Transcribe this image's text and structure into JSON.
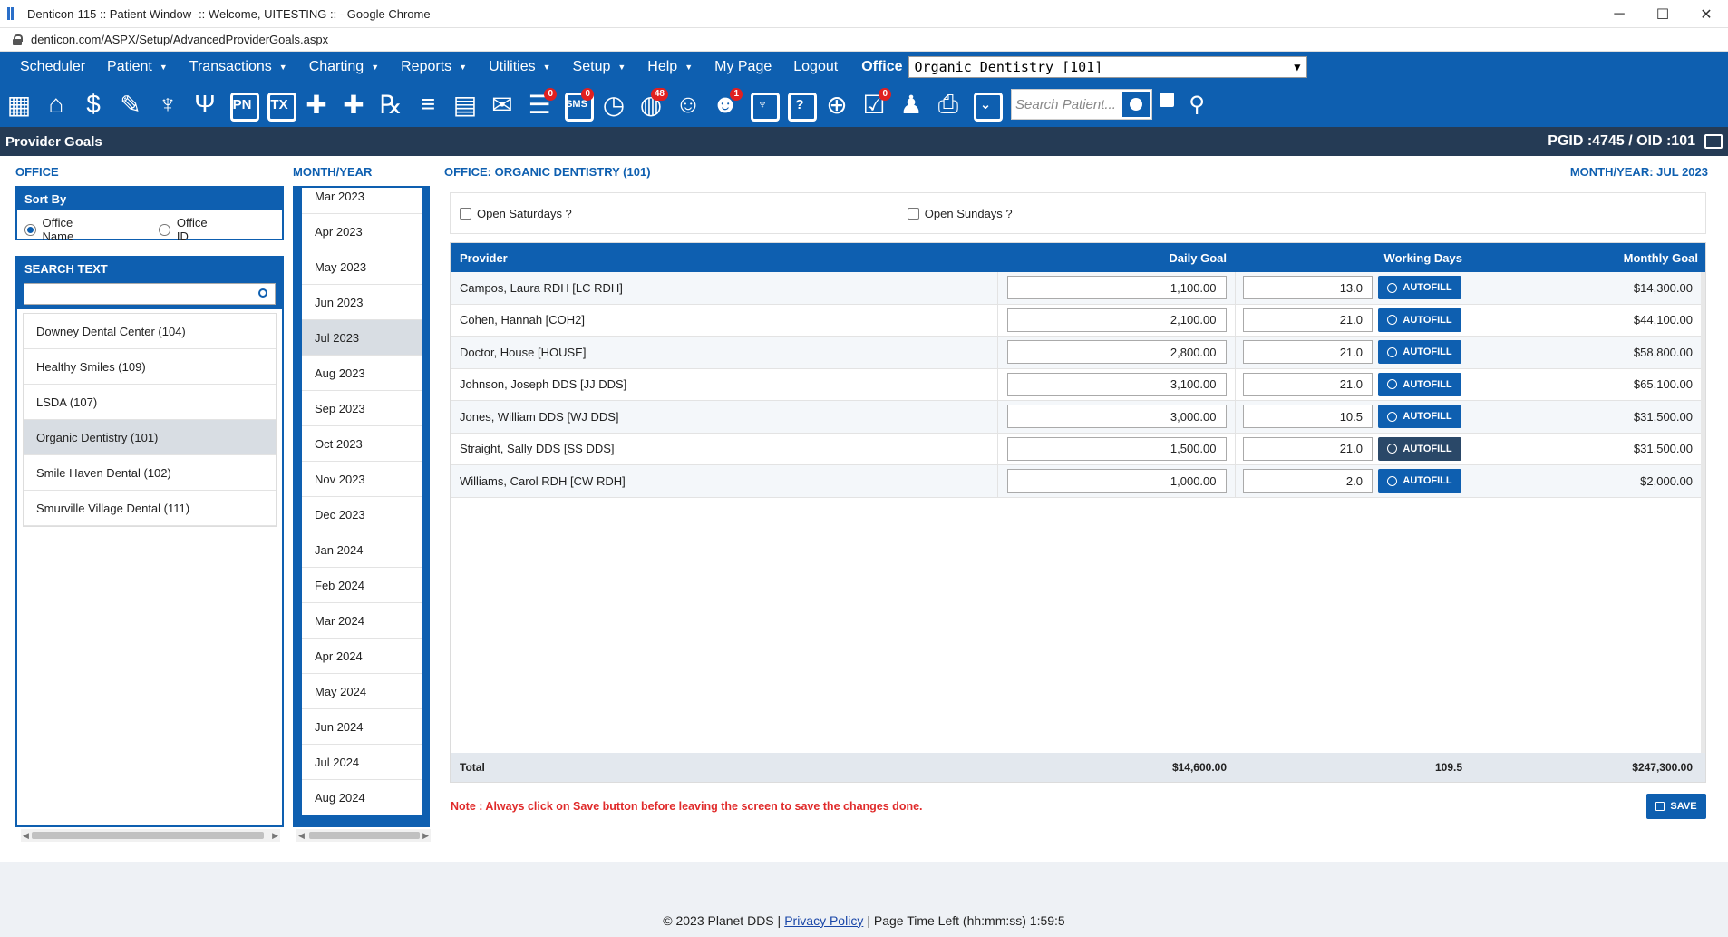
{
  "window": {
    "title": "Denticon-115 :: Patient Window -:: Welcome, UITESTING :: - Google Chrome",
    "url": "denticon.com/ASPX/Setup/AdvancedProviderGoals.aspx",
    "minimize": "─",
    "maximize": "☐",
    "close": "✕"
  },
  "menu": {
    "items": [
      {
        "label": "Scheduler",
        "caret": false
      },
      {
        "label": "Patient",
        "caret": true
      },
      {
        "label": "Transactions",
        "caret": true
      },
      {
        "label": "Charting",
        "caret": true
      },
      {
        "label": "Reports",
        "caret": true
      },
      {
        "label": "Utilities",
        "caret": true
      },
      {
        "label": "Setup",
        "caret": true
      },
      {
        "label": "Help",
        "caret": true
      },
      {
        "label": "My Page",
        "caret": false
      },
      {
        "label": "Logout",
        "caret": false
      }
    ],
    "caret_glyph": "▼",
    "office_label": "Office",
    "office_value": "Organic Dentistry [101]",
    "office_dropdown_glyph": "▼"
  },
  "toolbar": {
    "icons": [
      {
        "name": "calendar-icon",
        "glyph": "▦",
        "style": "plain"
      },
      {
        "name": "home-icon",
        "glyph": "⌂",
        "style": "plain"
      },
      {
        "name": "dollar-icon",
        "glyph": "$",
        "style": "plain"
      },
      {
        "name": "clinical-notes-icon",
        "glyph": "✎",
        "style": "plain"
      },
      {
        "name": "tooth-chart-icon",
        "glyph": "♆",
        "style": "plain"
      },
      {
        "name": "perio-icon",
        "glyph": "Ψ",
        "style": "plain"
      },
      {
        "name": "progress-notes-icon",
        "glyph": "PN",
        "style": "box"
      },
      {
        "name": "treatment-icon",
        "glyph": "TX",
        "style": "box"
      },
      {
        "name": "add-patient-icon",
        "glyph": "✚",
        "style": "plain"
      },
      {
        "name": "add-family-icon",
        "glyph": "✚",
        "style": "plain"
      },
      {
        "name": "prescription-icon",
        "glyph": "℞",
        "style": "plain"
      },
      {
        "name": "notes-icon",
        "glyph": "≡",
        "style": "plain"
      },
      {
        "name": "forms-icon",
        "glyph": "▤",
        "style": "plain"
      },
      {
        "name": "mail-icon",
        "glyph": "✉",
        "style": "plain"
      },
      {
        "name": "messages-icon",
        "glyph": "☰",
        "style": "plain",
        "badge": "0"
      },
      {
        "name": "sms-icon",
        "glyph": "SMS",
        "style": "box",
        "badge": "0"
      },
      {
        "name": "clock-icon",
        "glyph": "◷",
        "style": "plain"
      },
      {
        "name": "online-patients-icon",
        "glyph": "◍",
        "style": "plain",
        "badge": "48"
      },
      {
        "name": "support-icon",
        "glyph": "☺",
        "style": "plain"
      },
      {
        "name": "alerts-icon",
        "glyph": "☻",
        "style": "plain",
        "badge": "1"
      },
      {
        "name": "tooth-icon",
        "glyph": "♆",
        "style": "box"
      },
      {
        "name": "help-icon",
        "glyph": "?",
        "style": "box"
      },
      {
        "name": "web-icon",
        "glyph": "⊕",
        "style": "plain"
      },
      {
        "name": "tasks-icon",
        "glyph": "☑",
        "style": "plain",
        "badge": "0"
      },
      {
        "name": "staff-icon",
        "glyph": "♟",
        "style": "plain"
      },
      {
        "name": "printer-icon",
        "glyph": "⎙",
        "style": "plain"
      },
      {
        "name": "collapse-icon",
        "glyph": "⌄",
        "style": "box"
      }
    ],
    "search_placeholder": "Search Patient...",
    "advanced_search_glyph": "⚲"
  },
  "page": {
    "title": "Provider Goals",
    "ids": "PGID :4745  /  OID :101"
  },
  "left": {
    "office_header": "OFFICE",
    "sort_by_header": "Sort By",
    "sort_options": [
      {
        "label": "Office Name",
        "selected": true
      },
      {
        "label": "Office ID",
        "selected": false
      }
    ],
    "search_header": "SEARCH TEXT",
    "offices": [
      {
        "label": "Downey Dental Center (104)",
        "selected": false
      },
      {
        "label": "Healthy Smiles (109)",
        "selected": false
      },
      {
        "label": "LSDA (107)",
        "selected": false
      },
      {
        "label": "Organic Dentistry (101)",
        "selected": true
      },
      {
        "label": "Smile Haven Dental (102)",
        "selected": false
      },
      {
        "label": "Smurville Village Dental (111)",
        "selected": false
      }
    ]
  },
  "months": {
    "header": "MONTH/YEAR",
    "items": [
      {
        "label": "Mar 2023",
        "selected": false
      },
      {
        "label": "Apr 2023",
        "selected": false
      },
      {
        "label": "May 2023",
        "selected": false
      },
      {
        "label": "Jun 2023",
        "selected": false
      },
      {
        "label": "Jul 2023",
        "selected": true
      },
      {
        "label": "Aug 2023",
        "selected": false
      },
      {
        "label": "Sep 2023",
        "selected": false
      },
      {
        "label": "Oct 2023",
        "selected": false
      },
      {
        "label": "Nov 2023",
        "selected": false
      },
      {
        "label": "Dec 2023",
        "selected": false
      },
      {
        "label": "Jan 2024",
        "selected": false
      },
      {
        "label": "Feb 2024",
        "selected": false
      },
      {
        "label": "Mar 2024",
        "selected": false
      },
      {
        "label": "Apr 2024",
        "selected": false
      },
      {
        "label": "May 2024",
        "selected": false
      },
      {
        "label": "Jun 2024",
        "selected": false
      },
      {
        "label": "Jul 2024",
        "selected": false
      },
      {
        "label": "Aug 2024",
        "selected": false
      }
    ]
  },
  "main": {
    "office_title": "OFFICE: ORGANIC DENTISTRY (101)",
    "month_title": "MONTH/YEAR: JUL 2023",
    "open_saturdays": "Open Saturdays ?",
    "open_sundays": "Open Sundays ?",
    "columns": {
      "provider": "Provider",
      "daily_goal": "Daily Goal",
      "working_days": "Working Days",
      "monthly_goal": "Monthly Goal"
    },
    "autofill_label": "AUTOFILL",
    "rows": [
      {
        "provider": "Campos, Laura RDH [LC RDH]",
        "daily": "1,100.00",
        "days": "13.0",
        "monthly": "$14,300.00"
      },
      {
        "provider": "Cohen, Hannah [COH2]",
        "daily": "2,100.00",
        "days": "21.0",
        "monthly": "$44,100.00"
      },
      {
        "provider": "Doctor, House [HOUSE]",
        "daily": "2,800.00",
        "days": "21.0",
        "monthly": "$58,800.00"
      },
      {
        "provider": "Johnson, Joseph DDS [JJ DDS]",
        "daily": "3,100.00",
        "days": "21.0",
        "monthly": "$65,100.00"
      },
      {
        "provider": "Jones, William DDS [WJ DDS]",
        "daily": "3,000.00",
        "days": "10.5",
        "monthly": "$31,500.00"
      },
      {
        "provider": "Straight, Sally DDS [SS DDS]",
        "daily": "1,500.00",
        "days": "21.0",
        "monthly": "$31,500.00"
      },
      {
        "provider": "Williams, Carol RDH [CW RDH]",
        "daily": "1,000.00",
        "days": "2.0",
        "monthly": "$2,000.00"
      }
    ],
    "total": {
      "label": "Total",
      "daily": "$14,600.00",
      "days": "109.5",
      "monthly": "$247,300.00"
    },
    "note": "Note : Always click on Save button before leaving the screen to save the changes done.",
    "save_label": "SAVE"
  },
  "footer": {
    "copyright": "© 2023 Planet DDS |",
    "privacy": "Privacy Policy",
    "page_time": "| Page Time Left (hh:mm:ss) 1:59:5"
  }
}
